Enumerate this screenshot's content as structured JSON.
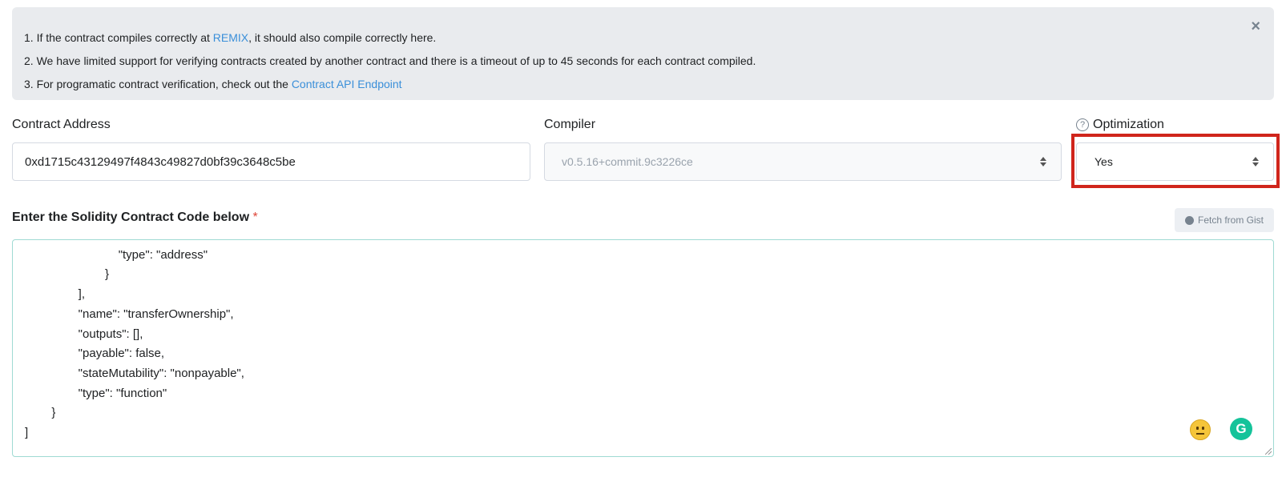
{
  "alert": {
    "line1_prefix": "1. If the contract compiles correctly at ",
    "line1_link": "REMIX",
    "line1_suffix": ", it should also compile correctly here.",
    "line2": "2. We have limited support for verifying contracts created by another contract and there is a timeout of up to 45 seconds for each contract compiled.",
    "line3_prefix": "3. For programatic contract verification, check out the ",
    "line3_link": "Contract API Endpoint",
    "close_icon": "×"
  },
  "form": {
    "contract_address_label": "Contract Address",
    "contract_address_value": "0xd1715c43129497f4843c49827d0bf39c3648c5be",
    "compiler_label": "Compiler",
    "compiler_value": "v0.5.16+commit.9c3226ce",
    "optimization_label": "Optimization",
    "optimization_help_icon": "?",
    "optimization_value": "Yes"
  },
  "code": {
    "title": "Enter the Solidity Contract Code below",
    "required_mark": "*",
    "fetch_gist_label": "Fetch from Gist",
    "content": "                            \"name\": \"newOwner\",\n                            \"type\": \"address\"\n                        }\n                ],\n                \"name\": \"transferOwnership\",\n                \"outputs\": [],\n                \"payable\": false,\n                \"stateMutability\": \"nonpayable\",\n                \"type\": \"function\"\n        }\n]"
  },
  "colors": {
    "link": "#3a8fd9",
    "highlight_border": "#d0251c",
    "code_border": "#9fdad3",
    "alert_bg": "#e9ebee"
  }
}
